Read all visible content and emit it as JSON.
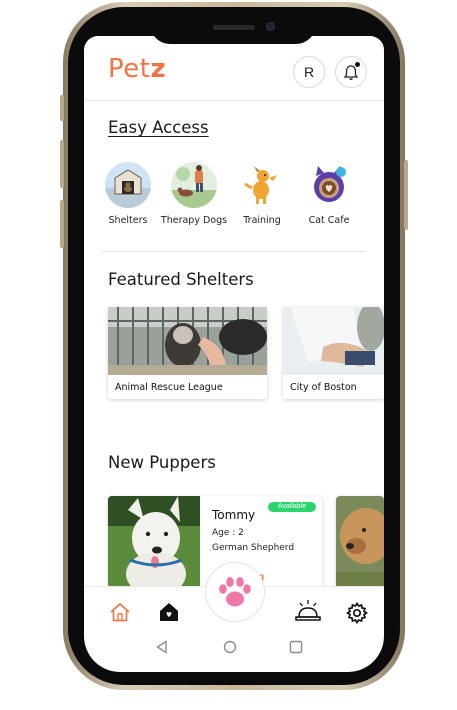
{
  "app": {
    "logo_text": "Pet",
    "logo_accent": "z",
    "brand_color": "#f07442"
  },
  "header": {
    "profile_initial": "R",
    "notification_icon": "bell-icon"
  },
  "easy_access": {
    "title": "Easy Access",
    "items": [
      {
        "label": "Shelters"
      },
      {
        "label": "Therapy Dogs"
      },
      {
        "label": "Training"
      },
      {
        "label": "Cat Cafe"
      }
    ]
  },
  "featured_shelters": {
    "title": "Featured Shelters",
    "cards": [
      {
        "name": "Animal Rescue League"
      },
      {
        "name": "City of Boston"
      }
    ]
  },
  "new_puppers": {
    "title": "New Puppers",
    "cards": [
      {
        "name": "Tommy",
        "age": "Age : 2",
        "breed": "German Shepherd",
        "status": "Available",
        "partial_text": "g"
      }
    ],
    "status_color": "#2bd46d"
  },
  "bottom_nav": {
    "items": [
      "home-icon",
      "shelter-house-icon",
      "paw-icon",
      "service-bell-icon",
      "settings-gear-icon"
    ]
  },
  "system_nav": {
    "items": [
      "back-icon",
      "home-circle-icon",
      "recents-icon"
    ]
  }
}
